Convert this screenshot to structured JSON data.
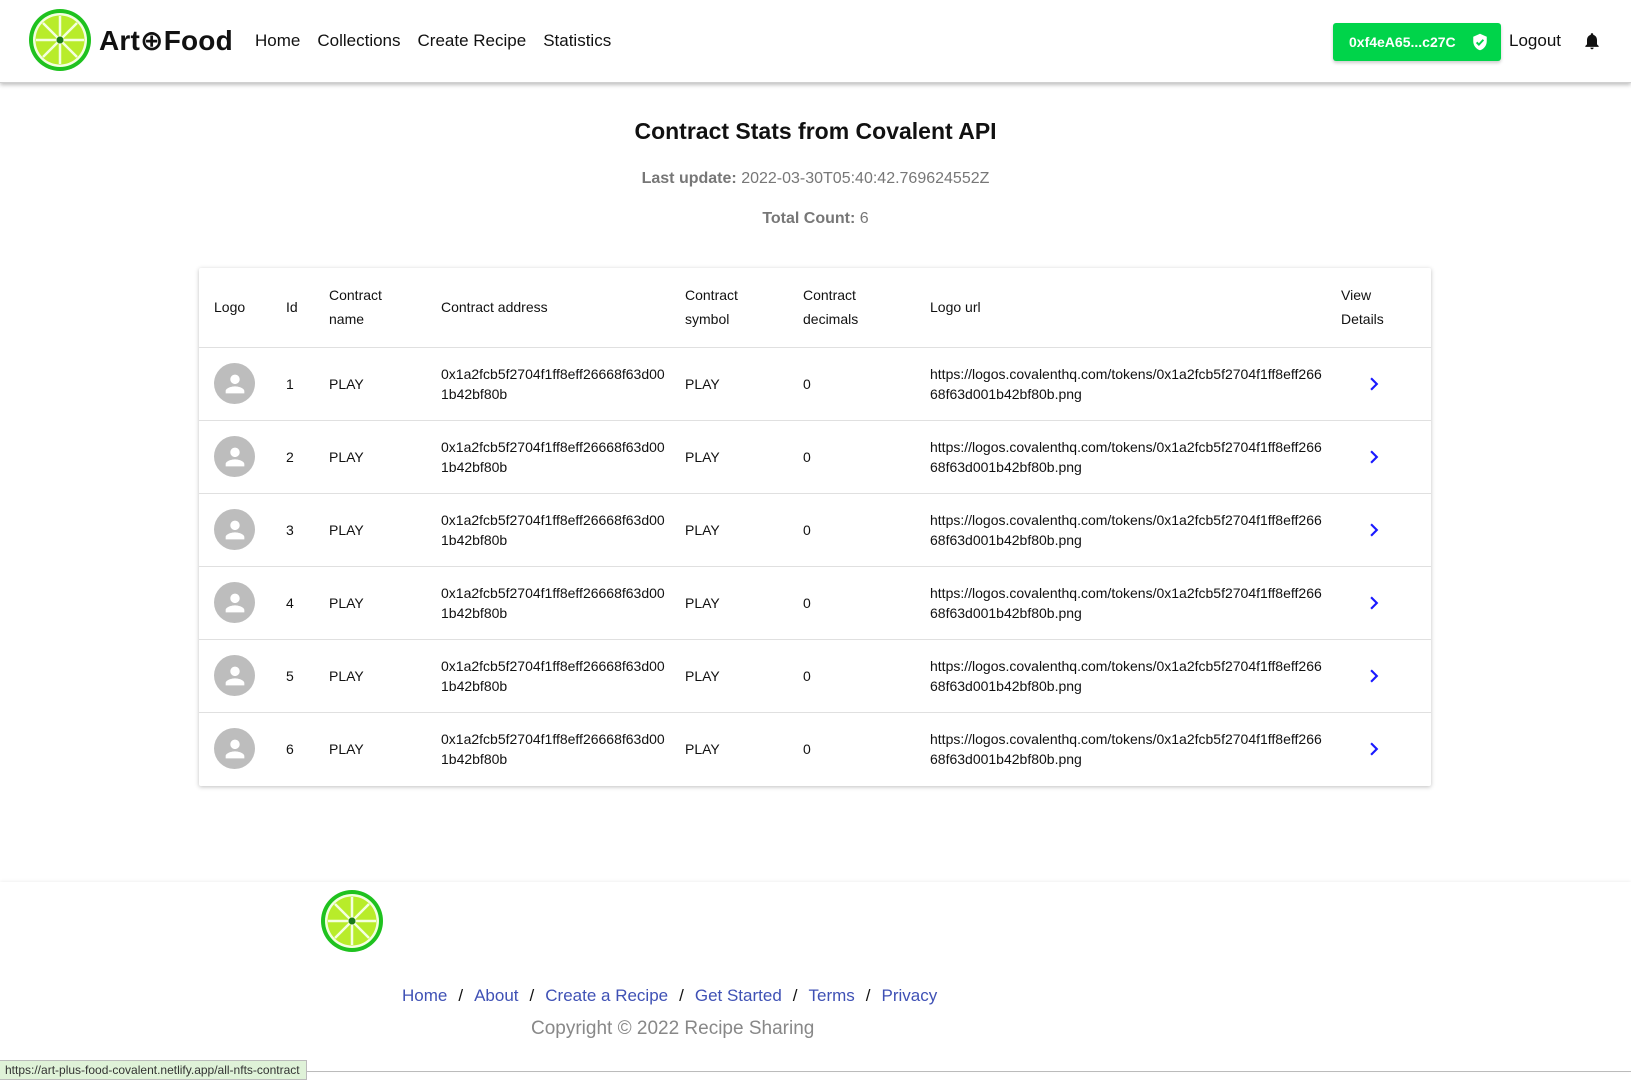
{
  "header": {
    "brand": "Art⊕Food",
    "nav": [
      "Home",
      "Collections",
      "Create Recipe",
      "Statistics"
    ],
    "wallet": "0xf4eA65...c27C",
    "logout": "Logout",
    "colors": {
      "accent_green": "#00d44a",
      "lime": "#9be22d"
    },
    "icons": {
      "logo": "lime-slice-icon",
      "wallet_status": "verified-shield-icon",
      "notifications": "bell-icon"
    }
  },
  "main": {
    "title": "Contract Stats from Covalent API",
    "last_update_label": "Last update:",
    "last_update_value": "2022-03-30T05:40:42.769624552Z",
    "total_count_label": "Total Count:",
    "total_count_value": "6",
    "table": {
      "headers": {
        "logo": "Logo",
        "id": "Id",
        "name_1": "Contract",
        "name_2": "name",
        "address": "Contract address",
        "symbol_1": "Contract",
        "symbol_2": "symbol",
        "decimals_1": "Contract",
        "decimals_2": "decimals",
        "logo_url": "Logo url",
        "details_1": "View",
        "details_2": "Details"
      },
      "rows": [
        {
          "id": "1",
          "name": "PLAY",
          "address": "0x1a2fcb5f2704f1ff8eff26668f63d001b42bf80b",
          "symbol": "PLAY",
          "decimals": "0",
          "logo_url": "https://logos.covalenthq.com/tokens/0x1a2fcb5f2704f1ff8eff26668f63d001b42bf80b.png"
        },
        {
          "id": "2",
          "name": "PLAY",
          "address": "0x1a2fcb5f2704f1ff8eff26668f63d001b42bf80b",
          "symbol": "PLAY",
          "decimals": "0",
          "logo_url": "https://logos.covalenthq.com/tokens/0x1a2fcb5f2704f1ff8eff26668f63d001b42bf80b.png"
        },
        {
          "id": "3",
          "name": "PLAY",
          "address": "0x1a2fcb5f2704f1ff8eff26668f63d001b42bf80b",
          "symbol": "PLAY",
          "decimals": "0",
          "logo_url": "https://logos.covalenthq.com/tokens/0x1a2fcb5f2704f1ff8eff26668f63d001b42bf80b.png"
        },
        {
          "id": "4",
          "name": "PLAY",
          "address": "0x1a2fcb5f2704f1ff8eff26668f63d001b42bf80b",
          "symbol": "PLAY",
          "decimals": "0",
          "logo_url": "https://logos.covalenthq.com/tokens/0x1a2fcb5f2704f1ff8eff26668f63d001b42bf80b.png"
        },
        {
          "id": "5",
          "name": "PLAY",
          "address": "0x1a2fcb5f2704f1ff8eff26668f63d001b42bf80b",
          "symbol": "PLAY",
          "decimals": "0",
          "logo_url": "https://logos.covalenthq.com/tokens/0x1a2fcb5f2704f1ff8eff26668f63d001b42bf80b.png"
        },
        {
          "id": "6",
          "name": "PLAY",
          "address": "0x1a2fcb5f2704f1ff8eff26668f63d001b42bf80b",
          "symbol": "PLAY",
          "decimals": "0",
          "logo_url": "https://logos.covalenthq.com/tokens/0x1a2fcb5f2704f1ff8eff26668f63d001b42bf80b.png"
        }
      ],
      "row_icons": {
        "avatar": "person-avatar-icon",
        "details": "chevron-right-icon"
      }
    }
  },
  "footer": {
    "links": [
      "Home",
      "About",
      "Create a Recipe",
      "Get Started",
      "Terms",
      "Privacy"
    ],
    "separator": "/",
    "copyright": "Copyright © 2022 Recipe Sharing",
    "link_color": "#3f51b5"
  },
  "statusbar": {
    "url": "https://art-plus-food-covalent.netlify.app/all-nfts-contract"
  }
}
